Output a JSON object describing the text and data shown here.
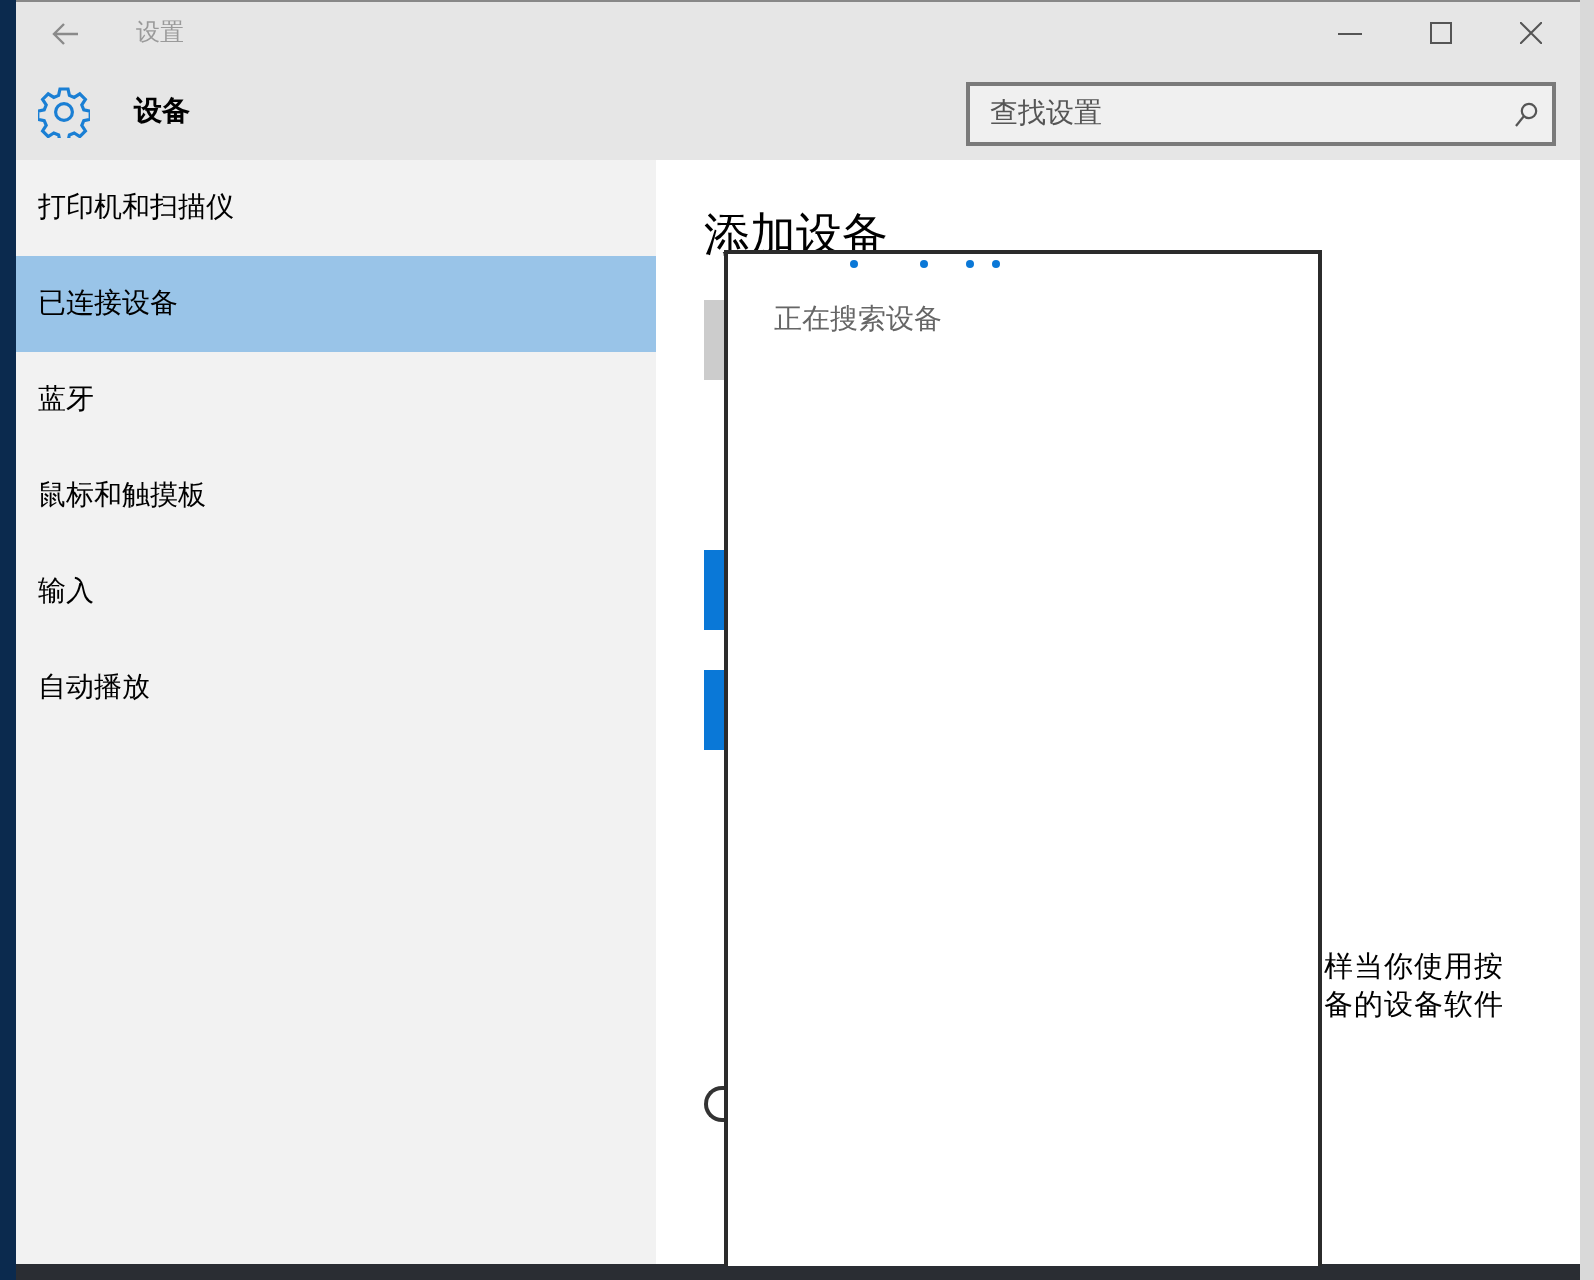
{
  "window": {
    "title": "设置"
  },
  "header": {
    "title": "设备",
    "search": {
      "placeholder": "查找设置"
    }
  },
  "sidebar": {
    "items": [
      {
        "label": "打印机和扫描仪",
        "selected": false
      },
      {
        "label": "已连接设备",
        "selected": true
      },
      {
        "label": "蓝牙",
        "selected": false
      },
      {
        "label": "鼠标和触摸板",
        "selected": false
      },
      {
        "label": "输入",
        "selected": false
      },
      {
        "label": "自动播放",
        "selected": false
      }
    ]
  },
  "main": {
    "heading": "添加设备",
    "paragraph_lines": [
      "样当你使用按",
      "备的设备软件"
    ]
  },
  "dialog": {
    "status": "正在搜索设备"
  }
}
